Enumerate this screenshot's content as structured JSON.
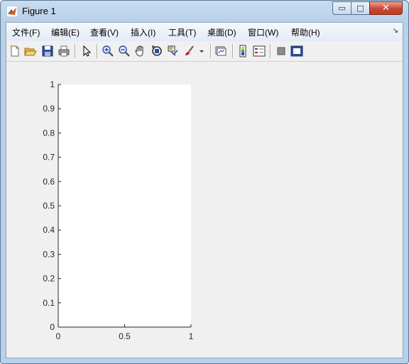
{
  "window": {
    "title": "Figure 1",
    "minimize_glyph": "▭",
    "maximize_glyph": "□",
    "close_glyph": "✕"
  },
  "menubar": {
    "items": [
      "文件(F)",
      "编辑(E)",
      "查看(V)",
      "插入(I)",
      "工具(T)",
      "桌面(D)",
      "窗口(W)",
      "帮助(H)"
    ],
    "end_glyph": "↘"
  },
  "toolbar": {
    "icons": [
      "new-figure-icon",
      "open-file-icon",
      "save-icon",
      "print-icon",
      "edit-plot-arrow-icon",
      "zoom-in-icon",
      "zoom-out-icon",
      "pan-hand-icon",
      "rotate-3d-icon",
      "data-cursor-icon",
      "brush-icon",
      "brush-dropdown-icon",
      "link-plot-icon",
      "insert-colorbar-icon",
      "insert-legend-icon",
      "hide-plot-tools-icon",
      "show-plot-tools-icon"
    ],
    "brush_color": "#c8102e"
  },
  "chart_data": {
    "type": "line",
    "series": [],
    "xlim": [
      0,
      1
    ],
    "ylim": [
      0,
      1
    ],
    "x_ticks": [
      "0",
      "0.5",
      "1"
    ],
    "y_ticks": [
      "0",
      "0.1",
      "0.2",
      "0.3",
      "0.4",
      "0.5",
      "0.6",
      "0.7",
      "0.8",
      "0.9",
      "1"
    ],
    "title": "",
    "xlabel": "",
    "ylabel": "",
    "grid": false,
    "axes_background": "#ffffff",
    "figure_background": "#f0f0f0"
  }
}
